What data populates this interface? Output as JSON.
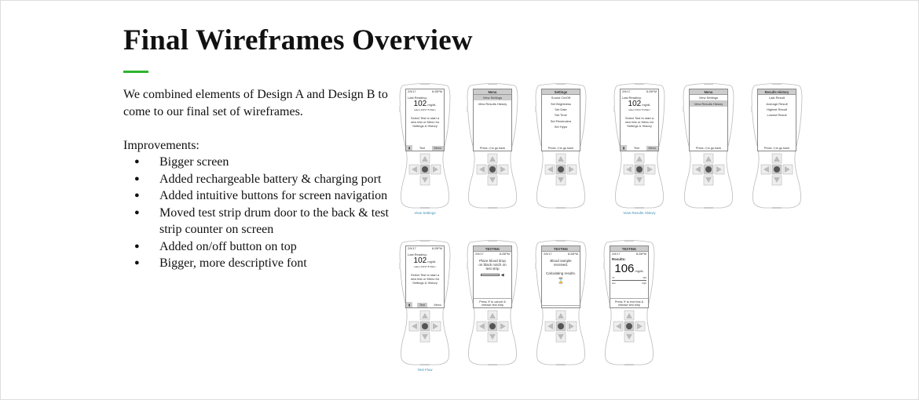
{
  "title": "Final Wireframes Overview",
  "accent_color": "#2db52d",
  "intro": "We combined elements of Design A and Design B to come to our final set of wireframes.",
  "improvements_label": "Improvements:",
  "improvements": [
    "Bigger screen",
    "Added rechargeable battery & charging port",
    "Added intuitive buttons for screen navigation",
    "Moved test strip drum door to the back & test strip counter on screen",
    "Added on/off button on top",
    "Bigger, more descriptive font"
  ],
  "devices": [
    {
      "type": "home",
      "date": "2/9/17",
      "time": "8:25PM",
      "label": "Last Reading:",
      "value": "102",
      "unit": "mg/dL",
      "taken": "taken 2/9/17 8:00am",
      "msg": "Select Test to start a new test or Menu for Settings & History",
      "buttons": [
        "Test",
        "Menu"
      ],
      "selected": "Menu",
      "caption": "View Settings"
    },
    {
      "type": "list",
      "header": "Menu",
      "items": [
        "View Settings",
        "View Results History"
      ],
      "selected": 0,
      "footer": "Press ◁ to go back"
    },
    {
      "type": "list",
      "header": "Settings",
      "items": [
        "Sound On/Off",
        "Set Brightness",
        "Set Date",
        "Set Time",
        "Set Reminders",
        "Set Hypo"
      ],
      "selected": -1,
      "footer": "Press ◁ to go back"
    },
    {
      "type": "home",
      "date": "2/9/17",
      "time": "8:25PM",
      "label": "Last Reading:",
      "value": "102",
      "unit": "mg/dL",
      "taken": "taken 2/9/17 8:00am",
      "msg": "Select Test to start a new test or Menu for Settings & History",
      "buttons": [
        "Test",
        "Menu"
      ],
      "selected": "Menu",
      "caption": "View Results History"
    },
    {
      "type": "list",
      "header": "Menu",
      "items": [
        "View Settings",
        "View Results History"
      ],
      "selected": 1,
      "footer": "Press ◁ to go back"
    },
    {
      "type": "list",
      "header": "Results History",
      "items": [
        "Last Result",
        "Average Result",
        "Highest Result",
        "Lowest Result"
      ],
      "selected": -1,
      "footer": "Press ◁ to go back"
    },
    {
      "type": "home",
      "date": "2/9/17",
      "time": "8:25PM",
      "label": "Last Reading:",
      "value": "102",
      "unit": "mg/dL",
      "taken": "taken 2/9/17 8:00am",
      "msg": "Select Test to start a new test or Menu for Settings & History",
      "buttons": [
        "Test",
        "Menu"
      ],
      "selected": "Test",
      "caption": "Test Flow"
    },
    {
      "type": "testing",
      "header": "TESTING",
      "date": "2/9/17",
      "time": "8:25PM",
      "lines": [
        "Place blood drop on black notch on test strip"
      ],
      "icon": "test-strip-icon",
      "footer": "Press ✕ to cancel & release test strip"
    },
    {
      "type": "testing",
      "header": "TESTING",
      "date": "2/9/17",
      "time": "8:25PM",
      "lines": [
        "Blood sample received.",
        "Calculating results."
      ],
      "icon": "hourglass-icon",
      "footer": ""
    },
    {
      "type": "result",
      "header": "TESTING",
      "date": "2/9/17",
      "time": "8:25PM",
      "label": "Results:",
      "value": "106",
      "unit": "mg/dL",
      "low": "70",
      "high": "110",
      "low_label": "low",
      "high_label": "high",
      "footer": "Press ✕ to end test & release test strip"
    }
  ]
}
